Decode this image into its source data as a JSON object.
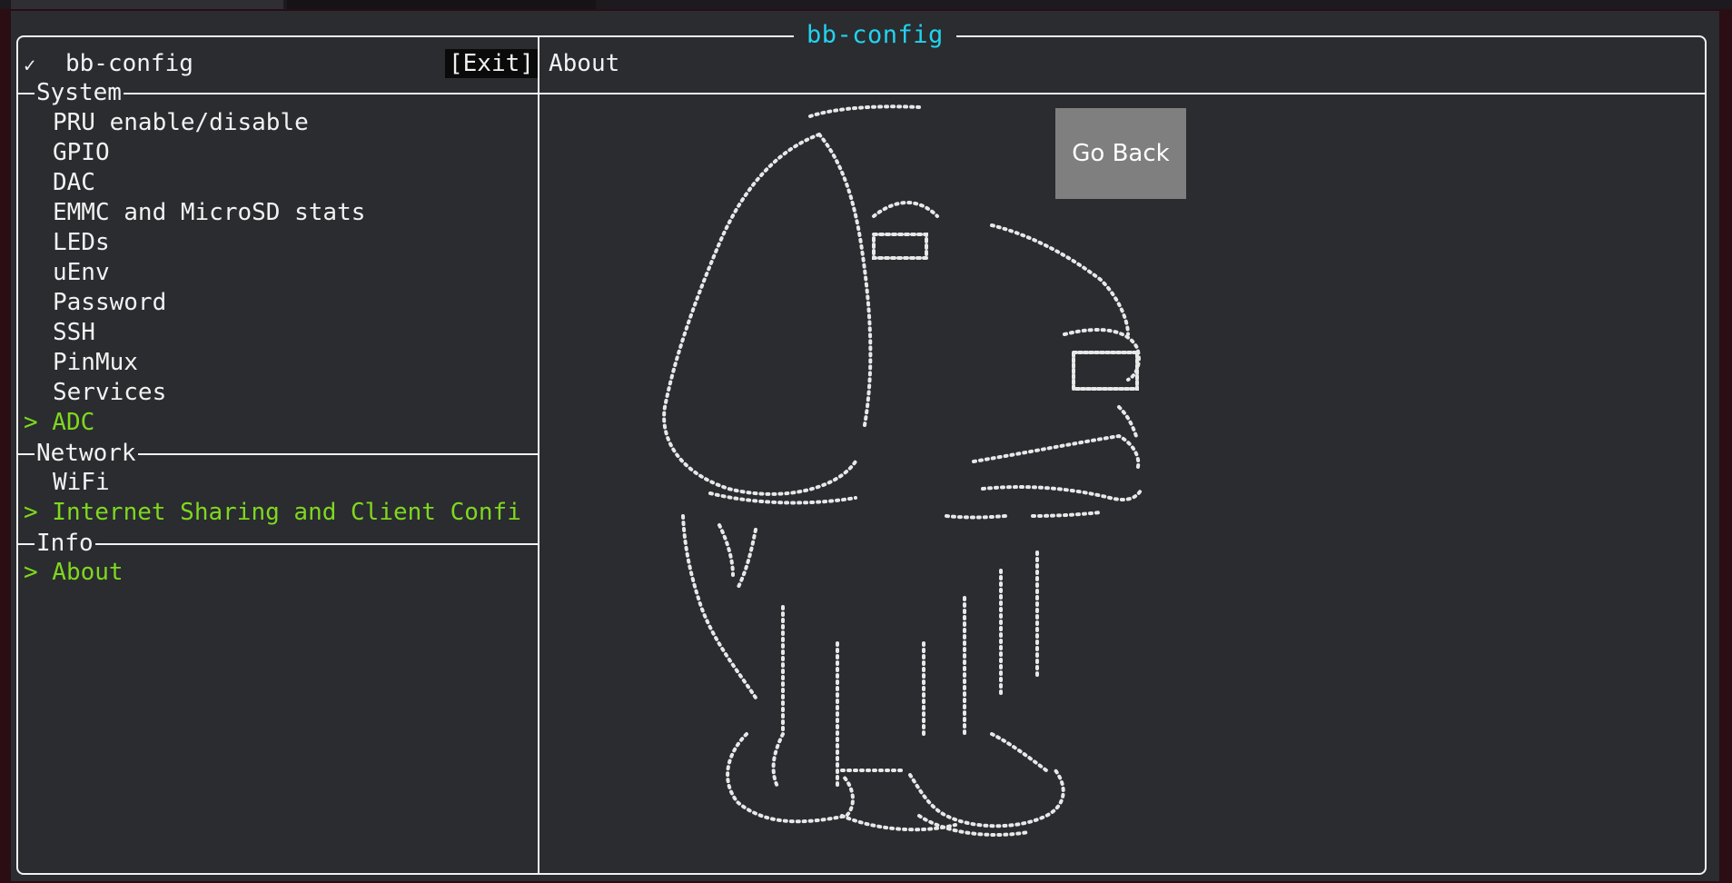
{
  "window": {
    "frame_title": "bb-config"
  },
  "sidebar": {
    "check_glyph": "✓",
    "app_title": "bb-config",
    "exit_label": "[Exit]",
    "sections": [
      {
        "label": "System",
        "items": [
          {
            "label": "PRU enable/disable"
          },
          {
            "label": "GPIO"
          },
          {
            "label": "DAC"
          },
          {
            "label": "EMMC and MicroSD stats"
          },
          {
            "label": "LEDs"
          },
          {
            "label": "uEnv"
          },
          {
            "label": "Password"
          },
          {
            "label": "SSH"
          },
          {
            "label": "PinMux"
          },
          {
            "label": "Services"
          },
          {
            "label": "> ADC"
          }
        ]
      },
      {
        "label": "Network",
        "items": [
          {
            "label": "WiFi"
          },
          {
            "label": "> Internet Sharing and Client Confi"
          }
        ]
      },
      {
        "label": "Info",
        "items": [
          {
            "label": "> About"
          }
        ]
      }
    ]
  },
  "main": {
    "title": "About",
    "go_back_label": "Go Back",
    "art_icon": "beagle-dog-braille-art-icon",
    "accent_colors": {
      "title": "#22d3ee",
      "selected": "#7fd81e",
      "button_bg": "#7f7f7f"
    }
  }
}
